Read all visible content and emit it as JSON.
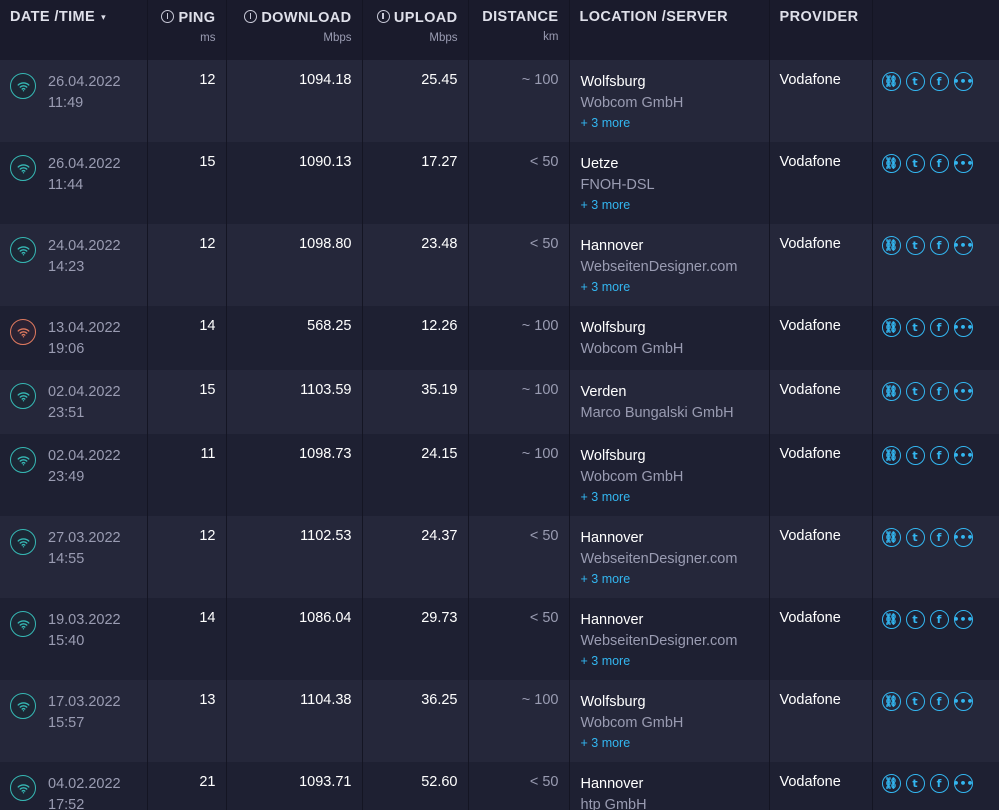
{
  "columns": [
    {
      "label": "DATE /TIME",
      "unit": ""
    },
    {
      "label": "PING",
      "unit": "ms"
    },
    {
      "label": "DOWNLOAD",
      "unit": "Mbps"
    },
    {
      "label": "UPLOAD",
      "unit": "Mbps"
    },
    {
      "label": "DISTANCE",
      "unit": "km"
    },
    {
      "label": "LOCATION /SERVER",
      "unit": ""
    },
    {
      "label": "PROVIDER",
      "unit": ""
    }
  ],
  "sort_indicator": "▾",
  "colors": {
    "wifi_good": "#36b8b4",
    "wifi_poor": "#e07a5f",
    "accent": "#33b6f0"
  },
  "results": [
    {
      "date": "26.04.2022",
      "time": "11:49",
      "ping": "12",
      "download": "1094.18",
      "upload": "25.45",
      "distance": "~ 100",
      "location": "Wolfsburg",
      "sponsor": "Wobcom GmbH",
      "more": "+ 3 more",
      "provider": "Vodafone",
      "signal": "good"
    },
    {
      "date": "26.04.2022",
      "time": "11:44",
      "ping": "15",
      "download": "1090.13",
      "upload": "17.27",
      "distance": "< 50",
      "location": "Uetze",
      "sponsor": "FNOH-DSL",
      "more": "+ 3 more",
      "provider": "Vodafone",
      "signal": "good"
    },
    {
      "date": "24.04.2022",
      "time": "14:23",
      "ping": "12",
      "download": "1098.80",
      "upload": "23.48",
      "distance": "< 50",
      "location": "Hannover",
      "sponsor": "WebseitenDesigner.com",
      "more": "+ 3 more",
      "provider": "Vodafone",
      "signal": "good"
    },
    {
      "date": "13.04.2022",
      "time": "19:06",
      "ping": "14",
      "download": "568.25",
      "upload": "12.26",
      "distance": "~ 100",
      "location": "Wolfsburg",
      "sponsor": "Wobcom GmbH",
      "more": "",
      "provider": "Vodafone",
      "signal": "poor"
    },
    {
      "date": "02.04.2022",
      "time": "23:51",
      "ping": "15",
      "download": "1103.59",
      "upload": "35.19",
      "distance": "~ 100",
      "location": "Verden",
      "sponsor": "Marco Bungalski GmbH",
      "more": "",
      "provider": "Vodafone",
      "signal": "good"
    },
    {
      "date": "02.04.2022",
      "time": "23:49",
      "ping": "11",
      "download": "1098.73",
      "upload": "24.15",
      "distance": "~ 100",
      "location": "Wolfsburg",
      "sponsor": "Wobcom GmbH",
      "more": "+ 3 more",
      "provider": "Vodafone",
      "signal": "good"
    },
    {
      "date": "27.03.2022",
      "time": "14:55",
      "ping": "12",
      "download": "1102.53",
      "upload": "24.37",
      "distance": "< 50",
      "location": "Hannover",
      "sponsor": "WebseitenDesigner.com",
      "more": "+ 3 more",
      "provider": "Vodafone",
      "signal": "good"
    },
    {
      "date": "19.03.2022",
      "time": "15:40",
      "ping": "14",
      "download": "1086.04",
      "upload": "29.73",
      "distance": "< 50",
      "location": "Hannover",
      "sponsor": "WebseitenDesigner.com",
      "more": "+ 3 more",
      "provider": "Vodafone",
      "signal": "good"
    },
    {
      "date": "17.03.2022",
      "time": "15:57",
      "ping": "13",
      "download": "1104.38",
      "upload": "36.25",
      "distance": "~ 100",
      "location": "Wolfsburg",
      "sponsor": "Wobcom GmbH",
      "more": "+ 3 more",
      "provider": "Vodafone",
      "signal": "good"
    },
    {
      "date": "04.02.2022",
      "time": "17:52",
      "ping": "21",
      "download": "1093.71",
      "upload": "52.60",
      "distance": "< 50",
      "location": "Hannover",
      "sponsor": "htp GmbH",
      "more": "",
      "provider": "Vodafone",
      "signal": "good"
    }
  ],
  "share_icons": [
    "link-icon",
    "twitter-icon",
    "facebook-icon",
    "more-options-icon"
  ]
}
